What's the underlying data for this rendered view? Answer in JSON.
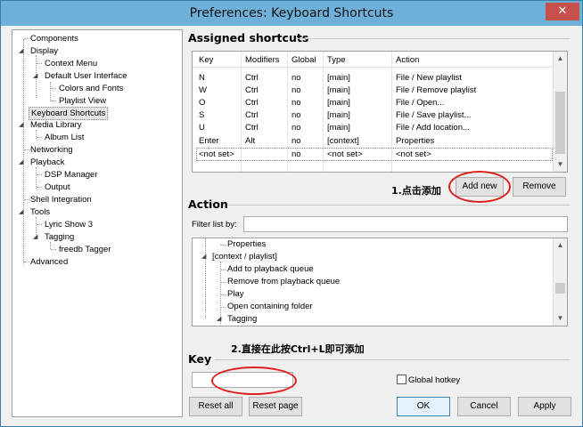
{
  "window": {
    "title": "Preferences: Keyboard Shortcuts",
    "close_glyph": "✕"
  },
  "tree": {
    "items": [
      {
        "label": "Components"
      },
      {
        "label": "Display"
      },
      {
        "label": "Context Menu"
      },
      {
        "label": "Default User Interface"
      },
      {
        "label": "Colors and Fonts"
      },
      {
        "label": "Playlist View"
      },
      {
        "label": "Keyboard Shortcuts"
      },
      {
        "label": "Media Library"
      },
      {
        "label": "Album List"
      },
      {
        "label": "Networking"
      },
      {
        "label": "Playback"
      },
      {
        "label": "DSP Manager"
      },
      {
        "label": "Output"
      },
      {
        "label": "Shell Integration"
      },
      {
        "label": "Tools"
      },
      {
        "label": "Lyric Show 3"
      },
      {
        "label": "Tagging"
      },
      {
        "label": "freedb Tagger"
      },
      {
        "label": "Advanced"
      }
    ],
    "selected": "Keyboard Shortcuts"
  },
  "assigned": {
    "title": "Assigned shortcuts",
    "columns": [
      "Key",
      "Modifiers",
      "Global",
      "Type",
      "Action"
    ],
    "rows": [
      [
        "N",
        "Ctrl",
        "no",
        "[main]",
        "File / New playlist"
      ],
      [
        "W",
        "Ctrl",
        "no",
        "[main]",
        "File / Remove playlist"
      ],
      [
        "O",
        "Ctrl",
        "no",
        "[main]",
        "File / Open..."
      ],
      [
        "S",
        "Ctrl",
        "no",
        "[main]",
        "File / Save playlist..."
      ],
      [
        "U",
        "Ctrl",
        "no",
        "[main]",
        "File / Add location..."
      ],
      [
        "Enter",
        "Alt",
        "no",
        "[context]",
        "Properties"
      ],
      [
        "<not set>",
        "",
        "no",
        "<not set>",
        "<not set>"
      ]
    ],
    "add_new": "Add new",
    "remove": "Remove"
  },
  "action": {
    "title": "Action",
    "filter_label": "Filter list by:",
    "filter_value": "",
    "items": [
      {
        "label": "Properties",
        "level": 2
      },
      {
        "label": "[context / playlist]",
        "level": 1
      },
      {
        "label": "Add to playback queue",
        "level": 2
      },
      {
        "label": "Remove from playback queue",
        "level": 2
      },
      {
        "label": "Play",
        "level": 2
      },
      {
        "label": "Open containing folder",
        "level": 2
      },
      {
        "label": "Tagging",
        "level": 2
      }
    ]
  },
  "key": {
    "title": "Key",
    "value": "",
    "global_hotkey_label": "Global hotkey",
    "global_hotkey_checked": false
  },
  "buttons": {
    "reset_all": "Reset all",
    "reset_page": "Reset page",
    "ok": "OK",
    "cancel": "Cancel",
    "apply": "Apply"
  },
  "annotations": {
    "note1": "1.点击添加",
    "note2": "2.直接在此按Ctrl+L即可添加",
    "highlight_color": "#e0201a"
  },
  "colors": {
    "titlebar": "#6eb0d9",
    "close": "#c7504a",
    "selection": "#e5e5e5"
  }
}
